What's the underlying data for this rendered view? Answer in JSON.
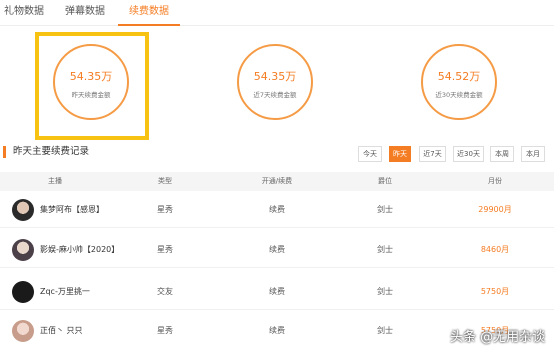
{
  "tabs": [
    "礼物数据",
    "弹幕数据",
    "续费数据"
  ],
  "stats": [
    {
      "value": "54.35万",
      "label": "昨天续费金额"
    },
    {
      "value": "54.35万",
      "label": "近7天续费金额"
    },
    {
      "value": "54.52万",
      "label": "近30天续费金额"
    }
  ],
  "section_title": "昨天主要续费记录",
  "filters": [
    "今天",
    "昨天",
    "近7天",
    "近30天",
    "本周",
    "本月"
  ],
  "active_filter": "昨天",
  "table": {
    "headers": [
      "主播",
      "类型",
      "开通/续费",
      "爵位",
      "月份"
    ],
    "rows": [
      {
        "name": "集梦阿布【感恩】",
        "type": "星秀",
        "action": "续费",
        "rank": "剑士",
        "month": "29900月"
      },
      {
        "name": "影娱-麻小帅【2020】",
        "type": "星秀",
        "action": "续费",
        "rank": "剑士",
        "month": "8460月"
      },
      {
        "name": "Zqc-万里挑一",
        "type": "交友",
        "action": "续费",
        "rank": "剑士",
        "month": "5750月"
      },
      {
        "name": "正佰丶 只只",
        "type": "星秀",
        "action": "续费",
        "rank": "剑士",
        "month": "5750月"
      }
    ]
  },
  "watermark": "头条 @无用杂谈",
  "colors": {
    "accent": "#f47c22",
    "highlight": "#f7c211"
  }
}
